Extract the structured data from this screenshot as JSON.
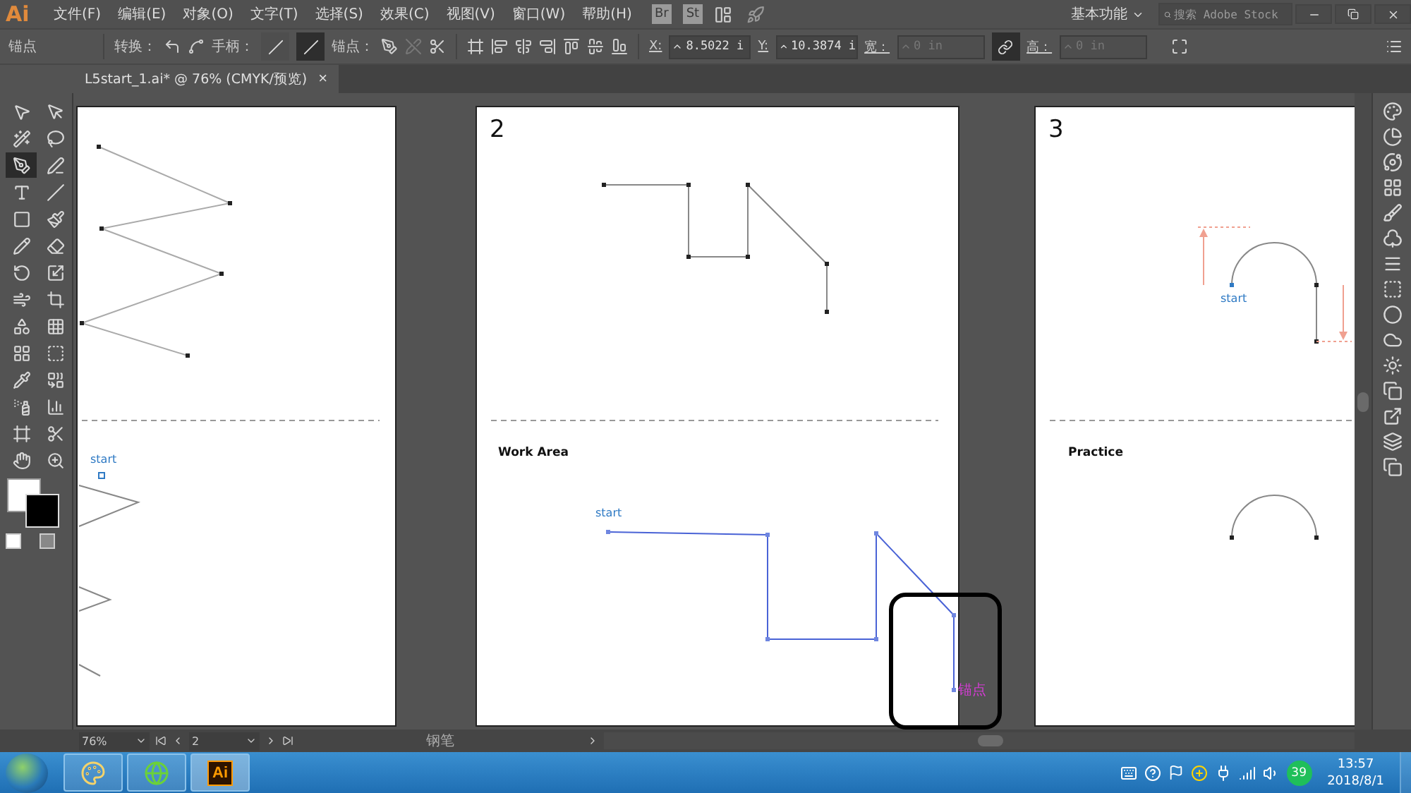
{
  "menu_bar": {
    "logo": "Ai",
    "items": [
      "文件(F)",
      "编辑(E)",
      "对象(O)",
      "文字(T)",
      "选择(S)",
      "效果(C)",
      "视图(V)",
      "窗口(W)",
      "帮助(H)"
    ],
    "bridge": "Br",
    "stock": "St",
    "workspace": "基本功能",
    "search": {
      "placeholder": "搜索 Adobe Stock"
    }
  },
  "control_bar": {
    "tool_name": "锚点",
    "convert_label": "转换：",
    "handles_label": "手柄：",
    "handles": [
      {
        "selected": false
      },
      {
        "selected": true
      }
    ],
    "anchor_label": "锚点：",
    "x_label": "X:",
    "x_value": "8.5022 i",
    "y_label": "Y:",
    "y_value": "10.3874 i",
    "w_label": "宽：",
    "w_value": "0 in",
    "h_label": "高：",
    "h_value": "0 in"
  },
  "document_tab": {
    "title": "L5start_1.ai* @ 76% (CMYK/预览)",
    "close": "×"
  },
  "tools": [
    {
      "selected": false
    },
    {
      "selected": false
    },
    {
      "selected": false
    },
    {
      "selected": false
    },
    {
      "selected": true
    },
    {
      "selected": false
    },
    {
      "selected": false
    },
    {
      "selected": false
    },
    {
      "selected": false
    },
    {
      "selected": false
    },
    {
      "selected": false
    },
    {
      "selected": false
    },
    {
      "selected": false
    },
    {
      "selected": false
    },
    {
      "selected": false
    },
    {
      "selected": false
    },
    {
      "selected": false
    },
    {
      "selected": false
    },
    {
      "selected": false
    },
    {
      "selected": false
    },
    {
      "selected": false
    },
    {
      "selected": false
    },
    {
      "selected": false
    },
    {
      "selected": false
    },
    {
      "selected": false
    },
    {
      "selected": false
    },
    {
      "selected": false
    },
    {
      "selected": false
    }
  ],
  "artboards": [
    {
      "start_label": "start"
    },
    {
      "number": "2",
      "start_label": "start",
      "section_label": "Work Area"
    },
    {
      "number": "3",
      "start_label": "start",
      "section_label": "Practice"
    }
  ],
  "anchor_tooltip": "锚点",
  "status_bar": {
    "zoom": "76%",
    "page": "2",
    "tool": "钢笔"
  },
  "taskbar": {
    "apps": [
      {
        "kind": "paint",
        "selected": false
      },
      {
        "kind": "browser",
        "selected": false
      },
      {
        "kind": "illustrator",
        "label": "Ai",
        "selected": true
      }
    ],
    "badge": "39",
    "time": "13:57",
    "date": "2018/8/1"
  }
}
